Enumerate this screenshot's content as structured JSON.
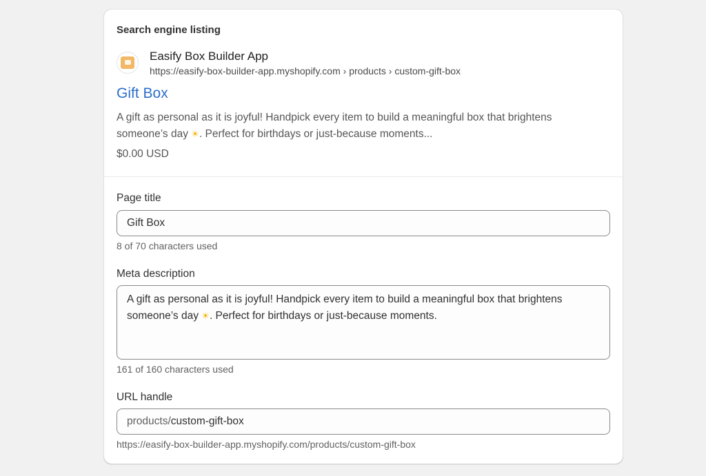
{
  "seo_preview": {
    "heading": "Search engine listing",
    "site_name": "Easify Box Builder App",
    "site_url": "https://easify-box-builder-app.myshopify.com › products › custom-gift-box",
    "title": "Gift Box",
    "description_part1": "A gift as personal as it is joyful! Handpick every item to build a meaningful box that brightens someone’s day ",
    "description_part2": ". Perfect for birthdays or just-because moments...",
    "sun_emoji": "☀",
    "price": "$0.00 USD"
  },
  "page_title": {
    "label": "Page title",
    "value": "Gift Box",
    "help": "8 of 70 characters used"
  },
  "meta_description": {
    "label": "Meta description",
    "value_part1": "A gift as personal as it is joyful! Handpick every item to build a meaningful box that brightens someone’s day ",
    "value_part2": ". Perfect for birthdays or just-because moments.",
    "help": "161 of 160 characters used"
  },
  "url_handle": {
    "label": "URL handle",
    "prefix": "products/",
    "value": "custom-gift-box",
    "help": "https://easify-box-builder-app.myshopify.com/products/custom-gift-box"
  },
  "colors": {
    "link_blue": "#2c6ecb",
    "card_bg": "#ffffff",
    "page_bg": "#f1f1f1"
  }
}
